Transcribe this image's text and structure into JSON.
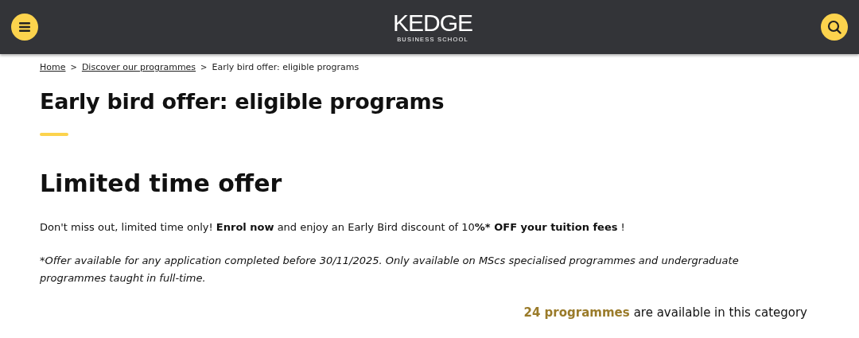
{
  "header": {
    "logo": "KEDGE",
    "logo_subtitle": "BUSINESS SCHOOL"
  },
  "breadcrumb": [
    {
      "label": "Home",
      "link": true
    },
    {
      "label": "Discover our programmes",
      "link": true
    },
    {
      "label": "Early bird offer: eligible programs",
      "link": false
    }
  ],
  "breadcrumb_separator": ">",
  "title": "Early bird offer: eligible programs",
  "subtitle": "Limited time offer",
  "intro": "Don't miss out, limited time only! **Enrol now** and enjoy an Early Bird discount of 10**%* OFF your tuition fees** !",
  "footnote": "*Offer available for any application completed before 30/11/2025. Only available on MScs specialised programmes and undergraduate programmes taught in full-time.",
  "results": {
    "count": "24 programmes",
    "text": "are available in this category"
  }
}
